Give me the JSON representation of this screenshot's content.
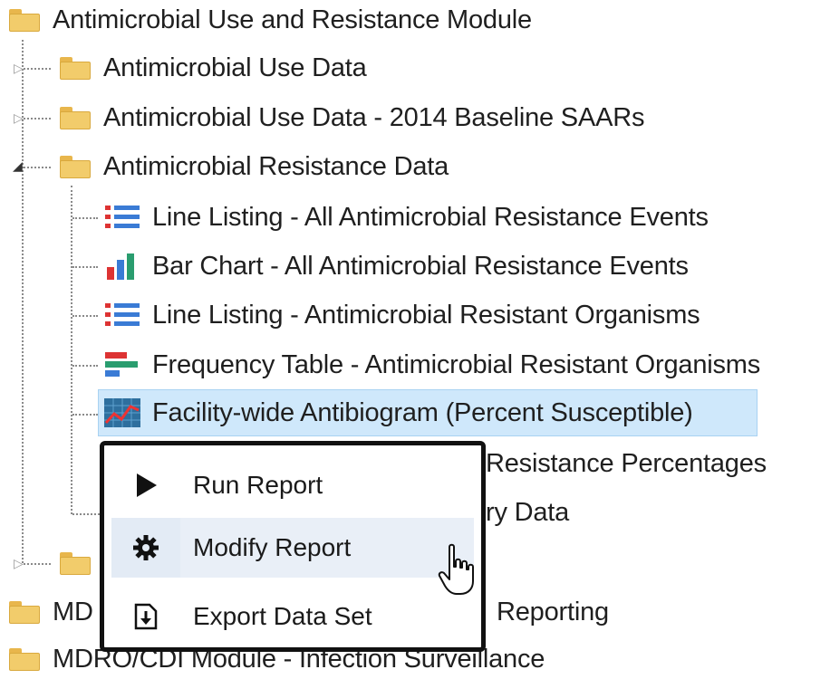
{
  "tree": {
    "root": {
      "label": "Antimicrobial Use and Resistance Module",
      "icon": "folder-icon"
    },
    "folders": [
      {
        "label": "Antimicrobial Use Data",
        "icon": "folder-icon",
        "state": "collapsed"
      },
      {
        "label": "Antimicrobial Use Data - 2014 Baseline SAARs",
        "icon": "folder-icon",
        "state": "collapsed"
      },
      {
        "label": "Antimicrobial Resistance Data",
        "icon": "folder-icon",
        "state": "expanded"
      }
    ],
    "reports": [
      {
        "label": "Line Listing - All Antimicrobial Resistance Events",
        "icon": "line-listing-icon"
      },
      {
        "label": "Bar Chart - All Antimicrobial Resistance Events",
        "icon": "bar-chart-icon"
      },
      {
        "label": "Line Listing - Antimicrobial Resistant Organisms",
        "icon": "line-listing-icon"
      },
      {
        "label": "Frequency Table - Antimicrobial Resistant Organisms",
        "icon": "frequency-table-icon"
      },
      {
        "label": "Facility-wide Antibiogram (Percent Susceptible)",
        "icon": "antibiogram-icon",
        "selected": true
      },
      {
        "label": "Resistance Percentages",
        "icon": "report-icon",
        "partially_hidden": true
      },
      {
        "label": "ry Data",
        "icon": "report-icon",
        "partially_hidden": true
      }
    ],
    "lower_folders": [
      {
        "label": "",
        "icon": "folder-icon",
        "state": "collapsed"
      },
      {
        "label": "MD",
        "label_tail": "Reporting",
        "icon": "folder-icon"
      },
      {
        "label": "MDRO/CDI Module - Infection Surveillance",
        "icon": "folder-icon"
      }
    ]
  },
  "context_menu": {
    "items": [
      {
        "label": "Run Report",
        "icon": "play-icon"
      },
      {
        "label": "Modify Report",
        "icon": "gear-icon",
        "hover": true
      },
      {
        "label": "Export Data Set",
        "icon": "export-icon"
      }
    ]
  },
  "colors": {
    "selection_bg": "#cfe8fb",
    "menu_border": "#111111",
    "menu_hover": "#e3ebf5",
    "folder": "#f2cc6b"
  }
}
